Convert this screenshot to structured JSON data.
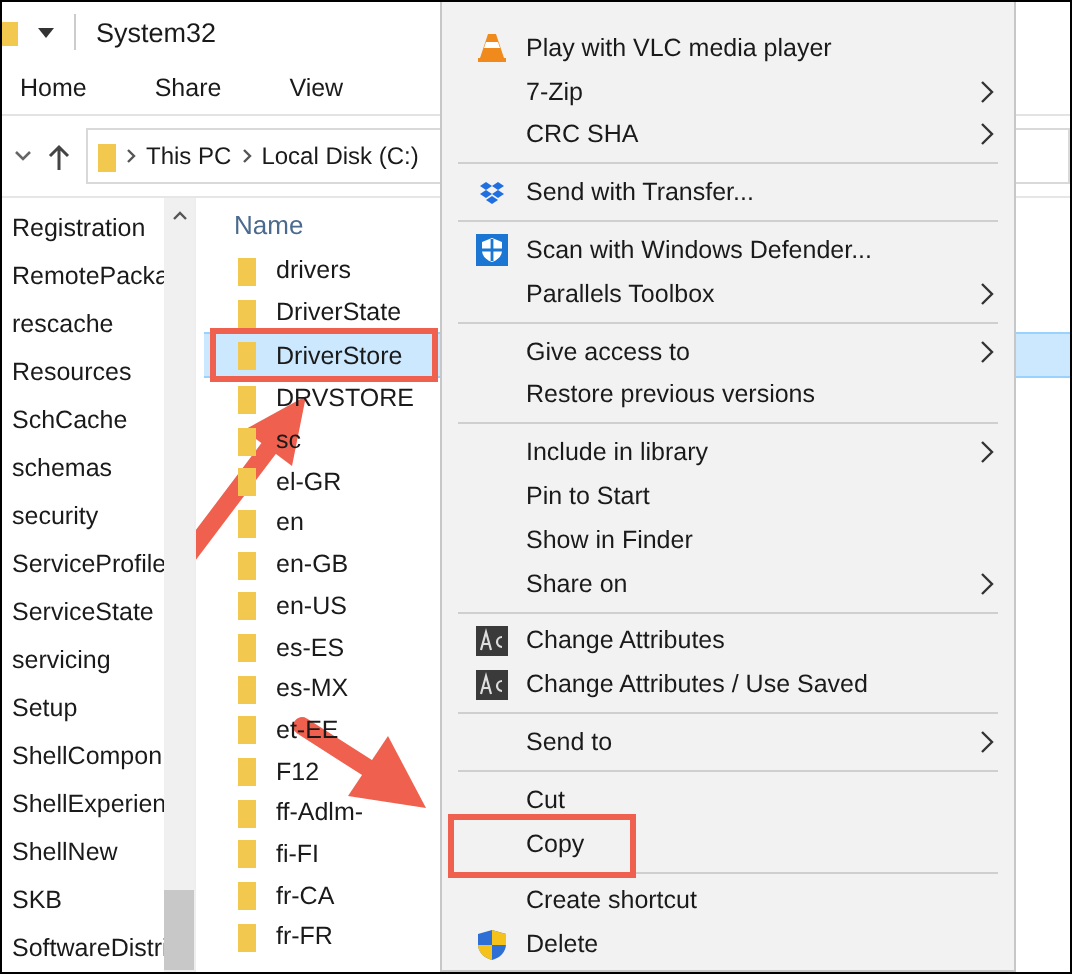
{
  "window": {
    "title": "System32"
  },
  "ribbon_tabs": [
    {
      "label": "Home",
      "selected": false
    },
    {
      "label": "Share",
      "selected": false
    },
    {
      "label": "View",
      "selected": false
    }
  ],
  "address_bar": {
    "path": [
      "This PC",
      "Local Disk (C:)"
    ]
  },
  "nav_pane": {
    "items": [
      "Registration",
      "RemotePacka",
      "rescache",
      "Resources",
      "SchCache",
      "schemas",
      "security",
      "ServiceProfile",
      "ServiceState",
      "servicing",
      "Setup",
      "ShellCompon",
      "ShellExperien",
      "ShellNew",
      "SKB",
      "SoftwareDistri"
    ]
  },
  "file_list": {
    "column": "Name",
    "rows": [
      {
        "name": "drivers",
        "selected": false,
        "highlighted": false
      },
      {
        "name": "DriverState",
        "selected": false,
        "highlighted": false
      },
      {
        "name": "DriverStore",
        "selected": true,
        "highlighted": true
      },
      {
        "name": "DRVSTORE",
        "selected": false,
        "highlighted": false
      },
      {
        "name": "sc",
        "selected": false,
        "highlighted": false
      },
      {
        "name": "el-GR",
        "selected": false,
        "highlighted": false
      },
      {
        "name": "en",
        "selected": false,
        "highlighted": false
      },
      {
        "name": "en-GB",
        "selected": false,
        "highlighted": false
      },
      {
        "name": "en-US",
        "selected": false,
        "highlighted": false
      },
      {
        "name": "es-ES",
        "selected": false,
        "highlighted": false
      },
      {
        "name": "es-MX",
        "selected": false,
        "highlighted": false
      },
      {
        "name": "et-EE",
        "selected": false,
        "highlighted": false
      },
      {
        "name": "F12",
        "selected": false,
        "highlighted": false
      },
      {
        "name": "ff-Adlm-",
        "selected": false,
        "highlighted": false
      },
      {
        "name": "fi-FI",
        "selected": false,
        "highlighted": false
      },
      {
        "name": "fr-CA",
        "selected": false,
        "highlighted": false
      },
      {
        "name": "fr-FR",
        "selected": false,
        "highlighted": false
      }
    ]
  },
  "context_menu": {
    "items": [
      {
        "kind": "vlc",
        "label": "Play with VLC media player",
        "submenu": false,
        "highlighted": false
      },
      {
        "kind": "plain",
        "label": "7-Zip",
        "submenu": true,
        "highlighted": false
      },
      {
        "kind": "plain",
        "label": "CRC SHA",
        "submenu": true,
        "highlighted": false
      },
      {
        "kind": "separator"
      },
      {
        "kind": "transfer",
        "label": "Send with Transfer...",
        "submenu": false,
        "highlighted": false
      },
      {
        "kind": "separator"
      },
      {
        "kind": "defender",
        "label": "Scan with Windows Defender...",
        "submenu": false,
        "highlighted": false
      },
      {
        "kind": "plain",
        "label": "Parallels Toolbox",
        "submenu": true,
        "highlighted": false
      },
      {
        "kind": "separator"
      },
      {
        "kind": "plain",
        "label": "Give access to",
        "submenu": true,
        "highlighted": false
      },
      {
        "kind": "plain",
        "label": "Restore previous versions",
        "submenu": false,
        "highlighted": false
      },
      {
        "kind": "separator"
      },
      {
        "kind": "plain",
        "label": "Include in library",
        "submenu": true,
        "highlighted": false
      },
      {
        "kind": "plain",
        "label": "Pin to Start",
        "submenu": false,
        "highlighted": false
      },
      {
        "kind": "plain",
        "label": "Show in Finder",
        "submenu": false,
        "highlighted": false
      },
      {
        "kind": "plain",
        "label": "Share on",
        "submenu": true,
        "highlighted": false
      },
      {
        "kind": "separator"
      },
      {
        "kind": "attributes",
        "label": "Change Attributes",
        "submenu": false,
        "highlighted": false
      },
      {
        "kind": "attributes",
        "label": "Change Attributes / Use Saved",
        "submenu": false,
        "highlighted": false
      },
      {
        "kind": "separator"
      },
      {
        "kind": "plain",
        "label": "Send to",
        "submenu": true,
        "highlighted": false
      },
      {
        "kind": "separator"
      },
      {
        "kind": "plain",
        "label": "Cut",
        "submenu": false,
        "highlighted": false
      },
      {
        "kind": "plain",
        "label": "Copy",
        "submenu": false,
        "highlighted": true
      },
      {
        "kind": "separator"
      },
      {
        "kind": "plain",
        "label": "Create shortcut",
        "submenu": false,
        "highlighted": false
      },
      {
        "kind": "uac",
        "label": "Delete",
        "submenu": false,
        "highlighted": false
      }
    ]
  }
}
